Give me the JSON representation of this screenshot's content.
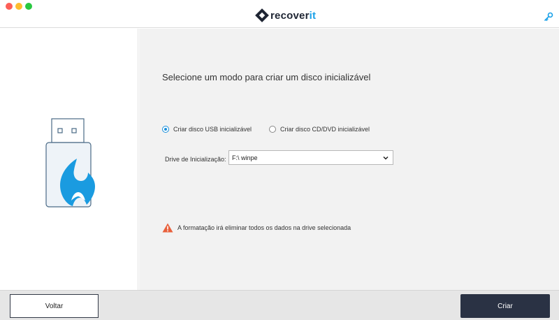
{
  "app": {
    "brand_prefix": "recover",
    "brand_suffix": "it",
    "accent_color": "#1aa1e8",
    "dark_color": "#2a3244"
  },
  "main": {
    "heading": "Selecione um modo para criar um disco inicializável",
    "modes": [
      {
        "label": "Criar disco USB inicializável",
        "selected": true
      },
      {
        "label": "Criar disco CD/DVD inicializável",
        "selected": false
      }
    ],
    "drive_label": "Drive de Inicialização:",
    "drive_value": "F:\\ winpe",
    "warning_text": "A formatação irá eliminar todos os dados na drive selecionada"
  },
  "footer": {
    "back_label": "Voltar",
    "create_label": "Criar"
  },
  "icons": {
    "titlebar": "key-icon",
    "art": "usb-drive-icon",
    "warning": "warning-icon"
  }
}
